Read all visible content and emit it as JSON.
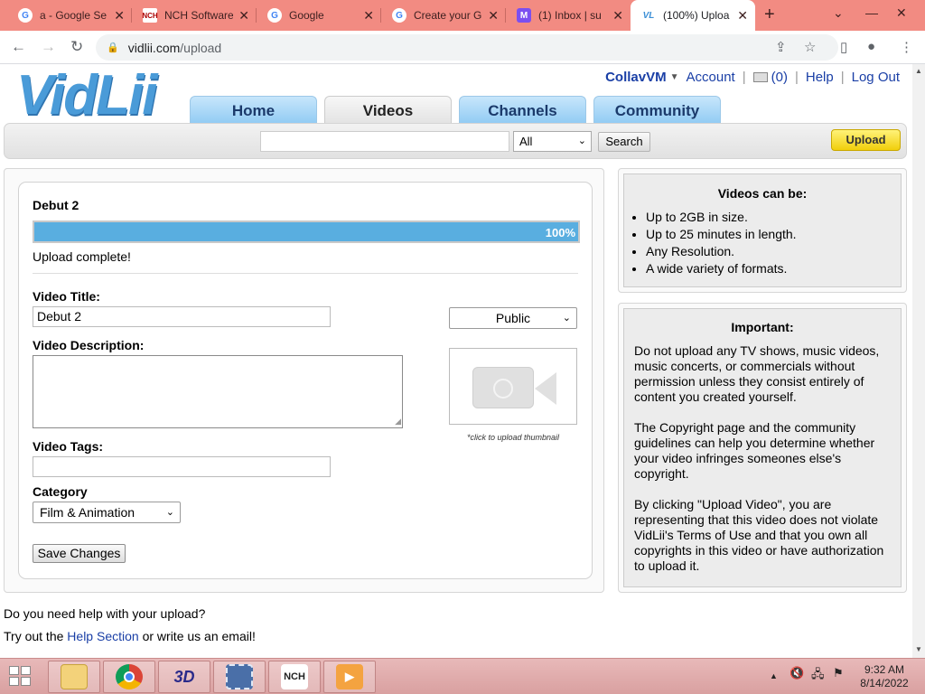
{
  "browser": {
    "tabs": [
      {
        "title": "a - Google Se",
        "icon": "google-icon"
      },
      {
        "title": "NCH Software",
        "icon": "nch-icon"
      },
      {
        "title": "Google",
        "icon": "google-icon"
      },
      {
        "title": "Create your G",
        "icon": "google-icon"
      },
      {
        "title": "(1) Inbox | su",
        "icon": "mail-icon"
      },
      {
        "title": "(100%) Uploa",
        "icon": "vidlii-icon"
      }
    ],
    "url_host": "vidlii.com",
    "url_path": "/upload"
  },
  "site": {
    "logo": "VidLii",
    "user": "CollavVM",
    "account_link": "Account",
    "inbox_count": "(0)",
    "help_link": "Help",
    "logout_link": "Log Out",
    "nav": [
      "Home",
      "Videos",
      "Channels",
      "Community"
    ],
    "search": {
      "query": "",
      "category": "All",
      "button": "Search"
    },
    "upload_button": "Upload"
  },
  "upload": {
    "filename": "Debut 2",
    "progress_percent": 100,
    "progress_label": "100%",
    "status": "Upload complete!",
    "title_label": "Video Title:",
    "title_value": "Debut 2",
    "privacy": "Public",
    "description_label": "Video Description:",
    "description_value": "",
    "thumbnail_note": "*click to upload thumbnail",
    "tags_label": "Video Tags:",
    "tags_value": "",
    "category_label": "Category",
    "category_value": "Film & Animation",
    "save_button": "Save Changes"
  },
  "help": {
    "line1": "Do you need help with your upload?",
    "line2_pre": "Try out the ",
    "line2_link": "Help Section",
    "line2_post": " or write us an email!"
  },
  "sidebar": {
    "videos_heading": "Videos can be:",
    "videos_items": [
      "Up to 2GB in size.",
      "Up to 25 minutes in length.",
      "Any Resolution.",
      "A wide variety of formats."
    ],
    "important_heading": "Important:",
    "important_paragraphs": [
      "Do not upload any TV shows, music videos, music concerts, or commercials without permission unless they consist entirely of content you created yourself.",
      "The Copyright page and the community guidelines can help you determine whether your video infringes someones else's copyright.",
      "By clicking \"Upload Video\", you are representing that this video does not violate VidLii's Terms of Use and that you own all copyrights in this video or have authorization to upload it."
    ]
  },
  "taskbar": {
    "time": "9:32 AM",
    "date": "8/14/2022"
  }
}
